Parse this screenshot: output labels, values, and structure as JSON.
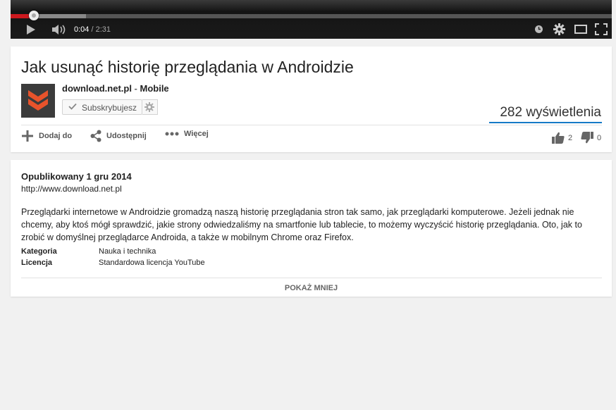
{
  "player": {
    "progress_fraction": 0.0382,
    "buffered_fraction": 0.126,
    "time_current": "0:04",
    "time_sep": " / ",
    "time_duration": "2:31",
    "icons": [
      "play-icon",
      "volume-icon",
      "watch-later-icon",
      "gear-icon",
      "theater-icon",
      "fullscreen-icon"
    ]
  },
  "video": {
    "title": "Jak usunąć historię przeglądania w Androidzie",
    "channel_name": "download.net.pl",
    "channel_sep": " - ",
    "channel_suffix": "Mobile",
    "subscribe_label": "Subskrybujesz",
    "views": "282 wyświetlenia",
    "accent_color": "#167ac6",
    "logo_color": "#e8532b"
  },
  "actions": {
    "add_label": "Dodaj do",
    "share_label": "Udostępnij",
    "more_label": "Więcej",
    "likes": "2",
    "dislikes": "0"
  },
  "description": {
    "published": "Opublikowany 1 gru 2014",
    "url": "http://www.download.net.pl",
    "text": "Przeglądarki internetowe w Androidzie gromadzą naszą historię przeglądania stron tak samo, jak przeglądarki komputerowe. Jeżeli jednak nie chcemy, aby ktoś mógł sprawdzić, jakie strony odwiedzaliśmy na smartfonie lub tablecie, to możemy wyczyścić historię przeglądania. Oto, jak to zrobić w domyślnej przeglądarce Androida, a także w mobilnym Chrome oraz Firefox.",
    "meta": [
      {
        "key": "Kategoria",
        "value": "Nauka i technika"
      },
      {
        "key": "Licencja",
        "value": "Standardowa licencja YouTube"
      }
    ],
    "show_less_label": "POKAŻ MNIEJ"
  }
}
